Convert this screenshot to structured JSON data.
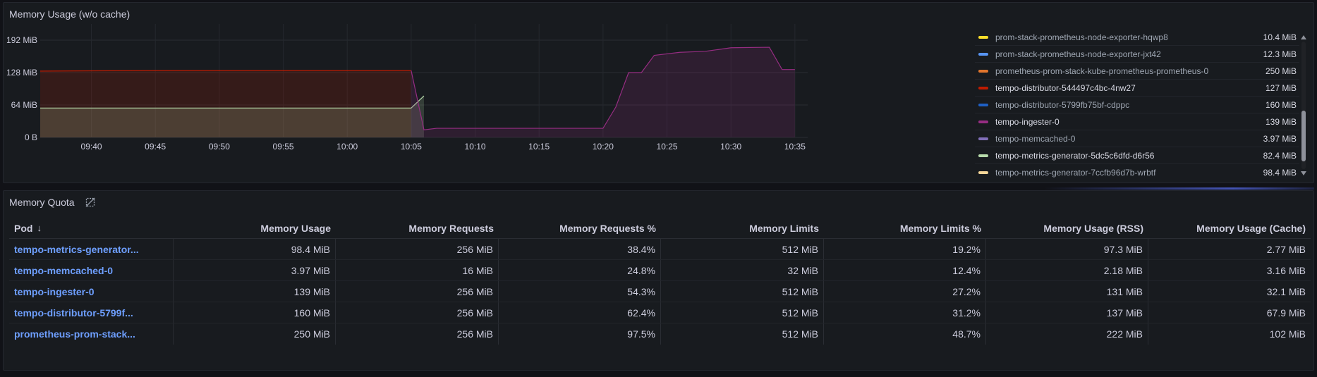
{
  "usage_panel": {
    "title": "Memory Usage (w/o cache)",
    "y_ticks": [
      "192 MiB",
      "128 MiB",
      "64 MiB",
      "0 B"
    ],
    "x_ticks": [
      "09:40",
      "09:45",
      "09:50",
      "09:55",
      "10:00",
      "10:05",
      "10:10",
      "10:15",
      "10:20",
      "10:25",
      "10:30",
      "10:35"
    ],
    "legend": [
      {
        "name": "prom-stack-prometheus-node-exporter-hqwp8",
        "value": "10.4 MiB",
        "color": "#fade2a",
        "bright": false
      },
      {
        "name": "prom-stack-prometheus-node-exporter-jxt42",
        "value": "12.3 MiB",
        "color": "#5794f2",
        "bright": false
      },
      {
        "name": "prometheus-prom-stack-kube-prometheus-prometheus-0",
        "value": "250 MiB",
        "color": "#e0752d",
        "bright": false
      },
      {
        "name": "tempo-distributor-544497c4bc-4nw27",
        "value": "127 MiB",
        "color": "#bf1b00",
        "bright": true
      },
      {
        "name": "tempo-distributor-5799fb75bf-cdppc",
        "value": "160 MiB",
        "color": "#1f60c4",
        "bright": false
      },
      {
        "name": "tempo-ingester-0",
        "value": "139 MiB",
        "color": "#962d82",
        "bright": true
      },
      {
        "name": "tempo-memcached-0",
        "value": "3.97 MiB",
        "color": "#806eb7",
        "bright": false
      },
      {
        "name": "tempo-metrics-generator-5dc5c6dfd-d6r56",
        "value": "82.4 MiB",
        "color": "#b7dbab",
        "bright": true
      },
      {
        "name": "tempo-metrics-generator-7ccfb96d7b-wrbtf",
        "value": "98.4 MiB",
        "color": "#f4d598",
        "bright": false
      }
    ]
  },
  "chart_data": {
    "type": "area",
    "title": "Memory Usage (w/o cache)",
    "y_unit": "MiB",
    "ylim": [
      0,
      224
    ],
    "x_range": [
      "09:36",
      "10:36"
    ],
    "series": [
      {
        "name": "tempo-distributor-544497c4bc-4nw27",
        "color": "#bf1b00",
        "points": [
          [
            "09:36",
            131
          ],
          [
            "09:45",
            132
          ],
          [
            "10:00",
            132
          ],
          [
            "10:05",
            132
          ]
        ]
      },
      {
        "name": "tempo-metrics-generator-5dc5c6dfd-d6r56",
        "color": "#b7dbab",
        "points": [
          [
            "09:36",
            58
          ],
          [
            "10:05",
            58
          ],
          [
            "10:06",
            82
          ]
        ]
      },
      {
        "name": "tempo-ingester-0",
        "color": "#962d82",
        "points": [
          [
            "10:05",
            132
          ],
          [
            "10:06",
            15
          ],
          [
            "10:07",
            18
          ],
          [
            "10:10",
            18
          ],
          [
            "10:20",
            18
          ],
          [
            "10:21",
            60
          ],
          [
            "10:22",
            128
          ],
          [
            "10:23",
            128
          ],
          [
            "10:24",
            162
          ],
          [
            "10:26",
            168
          ],
          [
            "10:28",
            170
          ],
          [
            "10:30",
            177
          ],
          [
            "10:33",
            178
          ],
          [
            "10:34",
            134
          ],
          [
            "10:35",
            134
          ]
        ]
      }
    ]
  },
  "quota_panel": {
    "title": "Memory Quota",
    "columns": [
      "Pod",
      "Memory Usage",
      "Memory Requests",
      "Memory Requests %",
      "Memory Limits",
      "Memory Limits %",
      "Memory Usage (RSS)",
      "Memory Usage (Cache)"
    ],
    "sort_indicator": "↓",
    "rows": [
      [
        "tempo-metrics-generator...",
        "98.4 MiB",
        "256 MiB",
        "38.4%",
        "512 MiB",
        "19.2%",
        "97.3 MiB",
        "2.77 MiB"
      ],
      [
        "tempo-memcached-0",
        "3.97 MiB",
        "16 MiB",
        "24.8%",
        "32 MiB",
        "12.4%",
        "2.18 MiB",
        "3.16 MiB"
      ],
      [
        "tempo-ingester-0",
        "139 MiB",
        "256 MiB",
        "54.3%",
        "512 MiB",
        "27.2%",
        "131 MiB",
        "32.1 MiB"
      ],
      [
        "tempo-distributor-5799f...",
        "160 MiB",
        "256 MiB",
        "62.4%",
        "512 MiB",
        "31.2%",
        "137 MiB",
        "67.9 MiB"
      ],
      [
        "prometheus-prom-stack...",
        "250 MiB",
        "256 MiB",
        "97.5%",
        "512 MiB",
        "48.7%",
        "222 MiB",
        "102 MiB"
      ]
    ]
  }
}
